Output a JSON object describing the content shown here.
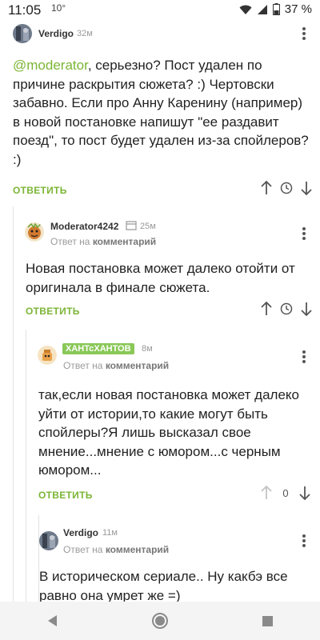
{
  "status_bar": {
    "time": "11:05",
    "temperature": "10°",
    "battery": "37 %",
    "icons": [
      "wifi-icon",
      "signal-icon",
      "battery-icon"
    ]
  },
  "comments": [
    {
      "author": "Verdigo",
      "time": "32м",
      "mention": "@moderator",
      "text": ", серьезно? Пост удален по причине раскрытия сюжета? :) Чертовски забавно. Если про Анну Каренину (например) в новой постановке напишут \"ее раздавит поезд\", то пост будет удален из-за спойлеров? :)",
      "reply_label": "ОТВЕТИТЬ"
    },
    {
      "author": "Moderator4242",
      "time": "25м",
      "reply_prefix": "Ответ на",
      "reply_target": "комментарий",
      "text": "Новая постановка может далеко отойти от оригинала в финале сюжета.",
      "reply_label": "ОТВЕТИТЬ"
    },
    {
      "author": "ХАНТсХАНТОВ",
      "time": "8м",
      "reply_prefix": "Ответ на",
      "reply_target": "комментарий",
      "text": "так,если новая постановка может далеко уйти от истории,то какие могут быть спойлеры?Я лишь высказал свое мнение...мнение с юмором...с черным юмором...",
      "reply_label": "ОТВЕТИТЬ",
      "score": "0"
    },
    {
      "author": "Verdigo",
      "time": "11м",
      "reply_prefix": "Ответ на",
      "reply_target": "комментарий",
      "text": "В историческом сериале.. Ну какбэ все равно она умрет же =)"
    }
  ],
  "colors": {
    "accent": "#7bb535",
    "author_badge": "#8ac858",
    "muted": "#9a9a9a"
  }
}
